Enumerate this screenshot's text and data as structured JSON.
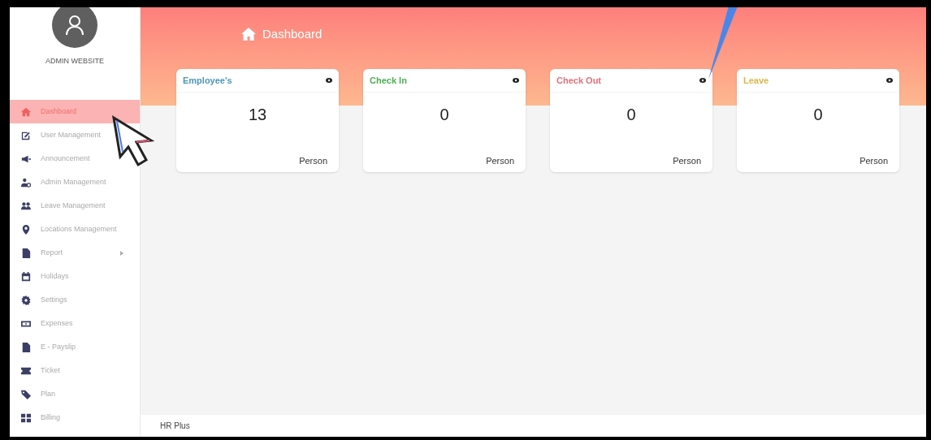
{
  "sidebar": {
    "user": {
      "name": "ADMIN WEBSITE"
    },
    "items": [
      {
        "label": "Dashboard",
        "selected": true,
        "submenu": false
      },
      {
        "label": "User Management",
        "selected": false,
        "submenu": false
      },
      {
        "label": "Announcement",
        "selected": false,
        "submenu": false
      },
      {
        "label": "Admin Management",
        "selected": false,
        "submenu": false
      },
      {
        "label": "Leave Management",
        "selected": false,
        "submenu": false
      },
      {
        "label": "Locations Management",
        "selected": false,
        "submenu": false
      },
      {
        "label": "Report",
        "selected": false,
        "submenu": true
      },
      {
        "label": "Holidays",
        "selected": false,
        "submenu": false
      },
      {
        "label": "Settings",
        "selected": false,
        "submenu": false
      },
      {
        "label": "Expenses",
        "selected": false,
        "submenu": false
      },
      {
        "label": "E - Payslip",
        "selected": false,
        "submenu": false
      },
      {
        "label": "Ticket",
        "selected": false,
        "submenu": false
      },
      {
        "label": "Plan",
        "selected": false,
        "submenu": false
      },
      {
        "label": "Billing",
        "selected": false,
        "submenu": false
      }
    ]
  },
  "header": {
    "title": "Dashboard"
  },
  "cards": [
    {
      "title": "Employee's",
      "color": "#4f97b8",
      "value": "13",
      "unit": "Person"
    },
    {
      "title": "Check In",
      "color": "#4caf50",
      "value": "0",
      "unit": "Person"
    },
    {
      "title": "Check Out",
      "color": "#e0707a",
      "value": "0",
      "unit": "Person"
    },
    {
      "title": "Leave",
      "color": "#d8b84a",
      "value": "0",
      "unit": "Person"
    }
  ],
  "footer": {
    "text": "HR Plus"
  }
}
